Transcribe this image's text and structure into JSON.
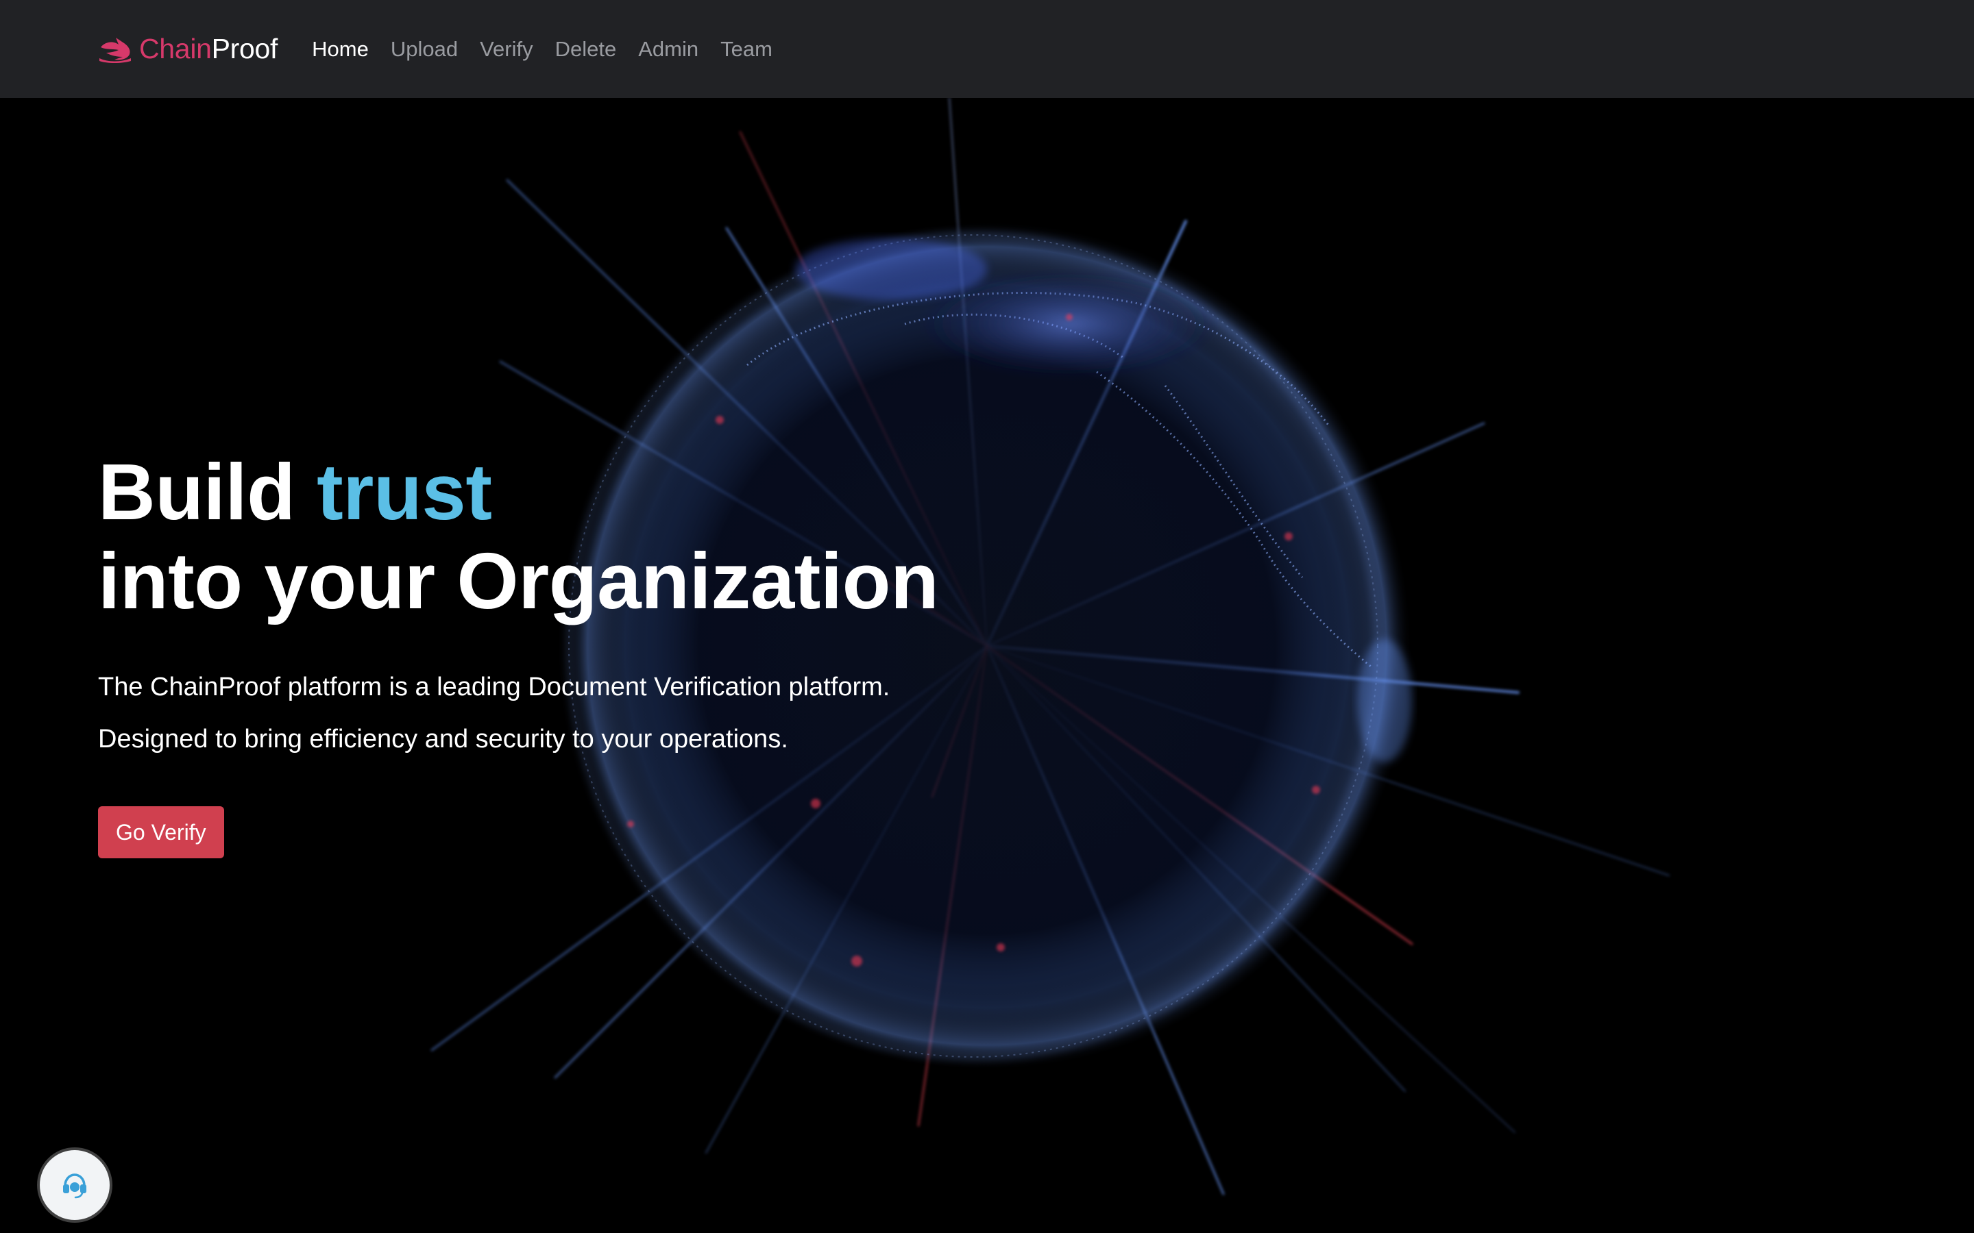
{
  "brand": {
    "name_part1": "Chain",
    "name_part2": "Proof",
    "icon": "chainproof-logo-icon"
  },
  "nav": {
    "items": [
      {
        "label": "Home",
        "active": true
      },
      {
        "label": "Upload",
        "active": false
      },
      {
        "label": "Verify",
        "active": false
      },
      {
        "label": "Delete",
        "active": false
      },
      {
        "label": "Admin",
        "active": false
      },
      {
        "label": "Team",
        "active": false
      }
    ]
  },
  "hero": {
    "headline_word1": "Build ",
    "headline_accent": "trust",
    "headline_line2": "into your Organization",
    "description_line1": "The ChainProof platform is a leading Document Verification platform.",
    "description_line2": "Designed to bring efficiency and security to your operations.",
    "cta_label": "Go Verify",
    "background_icon": "globe-network-illustration"
  },
  "support": {
    "icon": "headset-support-icon"
  },
  "colors": {
    "navbar_bg": "#212225",
    "brand_accent": "#d6396a",
    "headline_accent": "#5bbfe6",
    "cta_bg": "#d0404f",
    "page_bg": "#000000"
  }
}
